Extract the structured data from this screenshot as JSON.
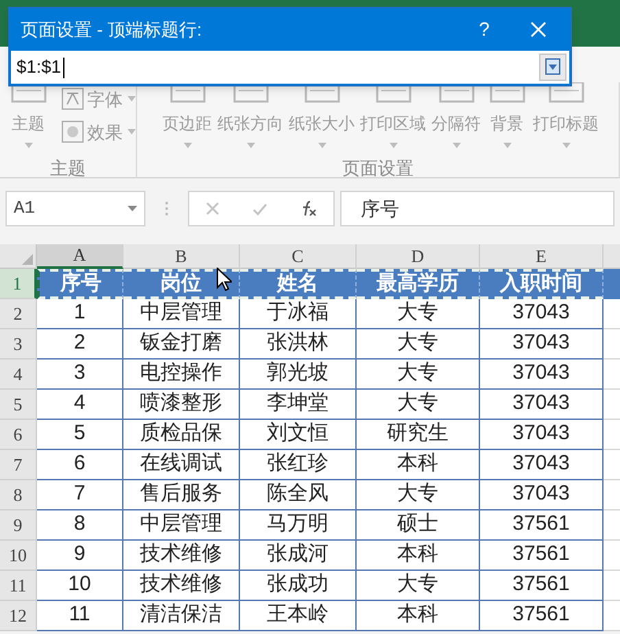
{
  "dialog": {
    "title": "页面设置 - 顶端标题行:",
    "help": "?",
    "value": "$1:$1"
  },
  "ribbon": {
    "groups": [
      {
        "label": "主题",
        "items": [
          {
            "kind": "big",
            "label": "主题"
          },
          {
            "kind": "small",
            "label": "字体"
          },
          {
            "kind": "small",
            "label": "效果"
          }
        ]
      },
      {
        "label": "页面设置",
        "items": [
          {
            "kind": "big",
            "label": "页边距"
          },
          {
            "kind": "big",
            "label": "纸张方向"
          },
          {
            "kind": "big",
            "label": "纸张大小"
          },
          {
            "kind": "big",
            "label": "打印区域"
          },
          {
            "kind": "big",
            "label": "分隔符"
          },
          {
            "kind": "big",
            "label": "背景"
          },
          {
            "kind": "big",
            "label": "打印标题"
          }
        ]
      }
    ]
  },
  "formula_bar": {
    "name_box": "A1",
    "formula": "序号"
  },
  "sheet": {
    "columns": [
      {
        "label": "A",
        "selected": true
      },
      {
        "label": "B",
        "selected": false
      },
      {
        "label": "C",
        "selected": false
      },
      {
        "label": "D",
        "selected": false
      },
      {
        "label": "E",
        "selected": false
      }
    ],
    "rows": [
      {
        "number": "1",
        "selected": true,
        "header": true,
        "cells": [
          "序号",
          "岗位",
          "姓名",
          "最高学历",
          "入职时间"
        ]
      },
      {
        "number": "2",
        "selected": false,
        "header": false,
        "cells": [
          "1",
          "中层管理",
          "于冰福",
          "大专",
          "37043"
        ]
      },
      {
        "number": "3",
        "selected": false,
        "header": false,
        "cells": [
          "2",
          "钣金打磨",
          "张洪林",
          "大专",
          "37043"
        ]
      },
      {
        "number": "4",
        "selected": false,
        "header": false,
        "cells": [
          "3",
          "电控操作",
          "郭光坡",
          "大专",
          "37043"
        ]
      },
      {
        "number": "5",
        "selected": false,
        "header": false,
        "cells": [
          "4",
          "喷漆整形",
          "李坤堂",
          "大专",
          "37043"
        ]
      },
      {
        "number": "6",
        "selected": false,
        "header": false,
        "cells": [
          "5",
          "质检品保",
          "刘文恒",
          "研究生",
          "37043"
        ]
      },
      {
        "number": "7",
        "selected": false,
        "header": false,
        "cells": [
          "6",
          "在线调试",
          "张红珍",
          "本科",
          "37043"
        ]
      },
      {
        "number": "8",
        "selected": false,
        "header": false,
        "cells": [
          "7",
          "售后服务",
          "陈全风",
          "大专",
          "37043"
        ]
      },
      {
        "number": "9",
        "selected": false,
        "header": false,
        "cells": [
          "8",
          "中层管理",
          "马万明",
          "硕士",
          "37561"
        ]
      },
      {
        "number": "10",
        "selected": false,
        "header": false,
        "cells": [
          "9",
          "技术维修",
          "张成河",
          "本科",
          "37561"
        ]
      },
      {
        "number": "11",
        "selected": false,
        "header": false,
        "cells": [
          "10",
          "技术维修",
          "张成功",
          "大专",
          "37561"
        ]
      },
      {
        "number": "12",
        "selected": false,
        "header": false,
        "cells": [
          "11",
          "清洁保洁",
          "王本岭",
          "本科",
          "37561"
        ]
      }
    ]
  }
}
